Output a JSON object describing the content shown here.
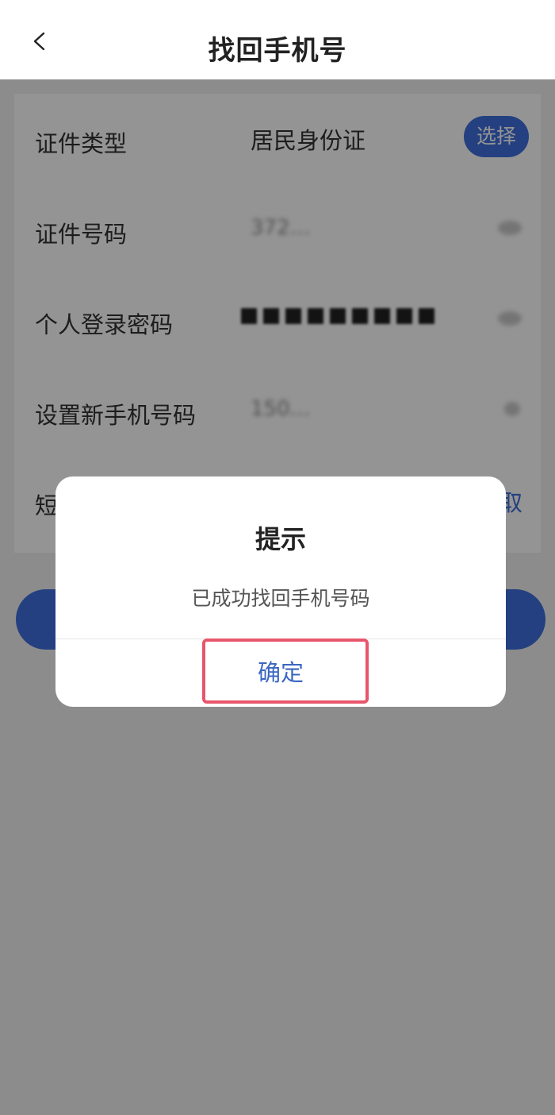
{
  "nav": {
    "title": "找回手机号",
    "back_icon": "chevron-left-icon"
  },
  "form": {
    "id_type": {
      "label": "证件类型",
      "value": "居民身份证",
      "button": "选择"
    },
    "id_number": {
      "label": "证件号码",
      "value": "372…"
    },
    "login_password": {
      "label": "个人登录密码"
    },
    "new_phone": {
      "label": "设置新手机号码",
      "value": "150…"
    },
    "sms_code": {
      "label": "短",
      "get_code": "取"
    }
  },
  "dialog": {
    "title": "提示",
    "message": "已成功找回手机号码",
    "confirm_label": "确定"
  },
  "colors": {
    "accent": "#3f6fdc",
    "confirm_text": "#3a66c0",
    "highlight": "#e8566c"
  }
}
